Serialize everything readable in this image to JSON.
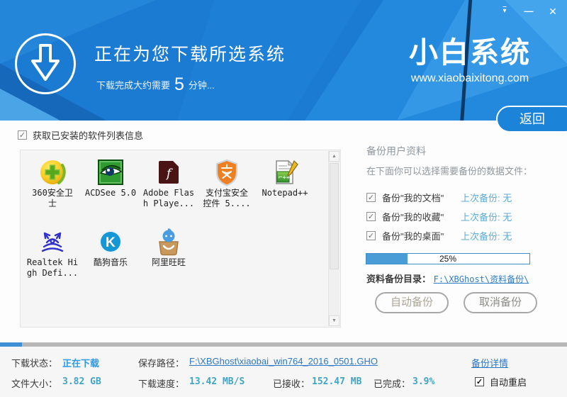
{
  "window": {
    "controls": {
      "menu": "▾",
      "minimize": "—",
      "close": "✕"
    },
    "logo": "小白系统",
    "website": "www.xiaobaixitong.com"
  },
  "header": {
    "title": "正在为您下载所选系统",
    "subtitle_prefix": "下载完成大约需要",
    "subtitle_minutes": "5",
    "subtitle_suffix": "分钟...",
    "back_button": "返回"
  },
  "software": {
    "checkbox_label": "获取已安装的软件列表信息",
    "checkbox_checked": true,
    "items": [
      {
        "name": "360安全卫\n士",
        "icon": "360-safety-icon"
      },
      {
        "name": "ACDSee 5.0",
        "icon": "acdsee-eye-icon"
      },
      {
        "name": "Adobe Flas\nh Playe...",
        "icon": "flash-player-icon"
      },
      {
        "name": "支付宝安全\n控件 5....",
        "icon": "alipay-shield-icon"
      },
      {
        "name": "Notepad++",
        "icon": "notepad-plus-icon"
      },
      {
        "name": "Realtek Hi\ngh Defi...",
        "icon": "realtek-crab-icon"
      },
      {
        "name": "酷狗音乐",
        "icon": "kugou-music-icon"
      },
      {
        "name": "阿里旺旺",
        "icon": "aliwangwang-icon"
      }
    ]
  },
  "backup": {
    "title": "备份用户资料",
    "description": "在下面你可以选择需要备份的数据文件：",
    "items": [
      {
        "label": "备份\"我的文档\"",
        "last_backup": "上次备份: 无",
        "checked": true
      },
      {
        "label": "备份\"我的收藏\"",
        "last_backup": "上次备份: 无",
        "checked": true
      },
      {
        "label": "备份\"我的桌面\"",
        "last_backup": "上次备份: 无",
        "checked": true
      }
    ],
    "progress_percent": "25%",
    "progress_value": 25,
    "dir_label": "资料备份目录：",
    "dir_path": "F:\\XBGhost\\资料备份\\",
    "auto_button": "自动备份",
    "cancel_button": "取消备份"
  },
  "status": {
    "overall_progress_value": 3.9,
    "download_status_label": "下载状态：",
    "download_status": "正在下载",
    "save_path_label": "保存路径：",
    "save_path": "F:\\XBGhost\\xiaobai_win764_2016_0501.GHO",
    "backup_details_link": "备份详情",
    "file_size_label": "文件大小：",
    "file_size": "3.82 GB",
    "speed_label": "下载速度：",
    "speed": "13.42 MB/S",
    "received_label": "已接收：",
    "received": "152.47 MB",
    "completed_label": "已完成：",
    "completed": "3.9%",
    "auto_restart_label": "自动重启",
    "auto_restart_checked": true
  },
  "colors": {
    "header_blue": "#1b7ad2",
    "accent_blue": "#2d9ae3",
    "value_teal": "#3fa5c5",
    "link_blue": "#2e77c5",
    "light_link_blue": "#5fabd8",
    "progress_blue": "#4a9cd6"
  }
}
